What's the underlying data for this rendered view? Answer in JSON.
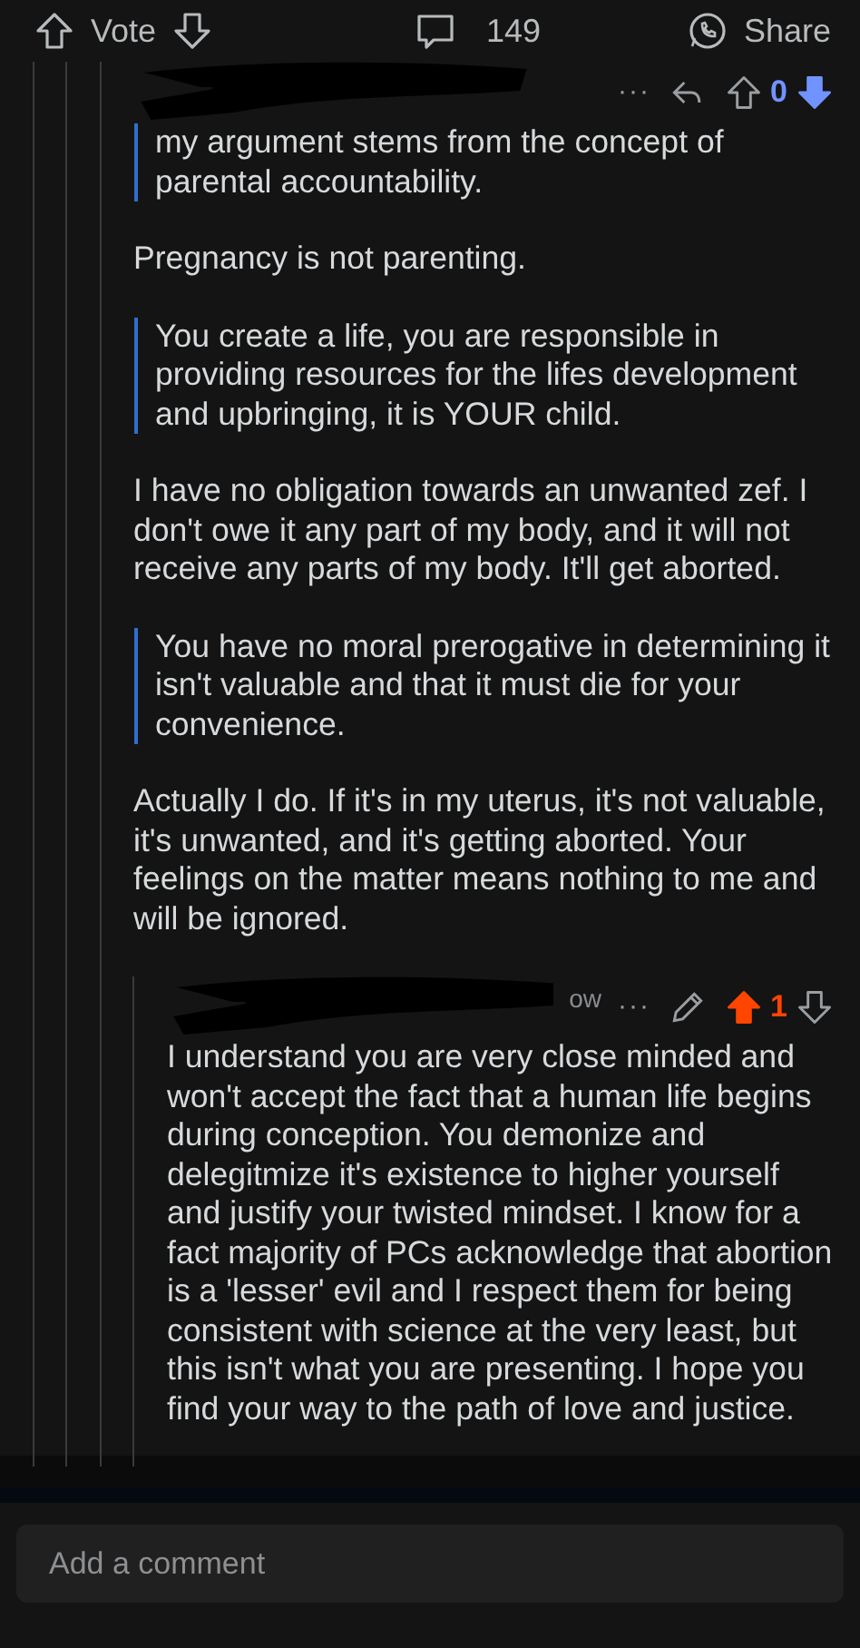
{
  "post_bar": {
    "vote_label": "Vote",
    "comment_count": "149",
    "share_label": "Share"
  },
  "comments": [
    {
      "more": "···",
      "own": false,
      "score": "0",
      "upvoted": false,
      "downvoted": true,
      "blocks": [
        {
          "kind": "quote",
          "text": "my argument stems from the concept of parental accountability."
        },
        {
          "kind": "paragraph",
          "text": "Pregnancy is not parenting."
        },
        {
          "kind": "quote",
          "text": "You create a life, you are responsible in providing resources for the lifes development and upbringing, it is YOUR child."
        },
        {
          "kind": "paragraph",
          "text": "I have no obligation towards an unwanted zef. I don't owe it any part of my body, and it will not receive any parts of my body. It'll get aborted."
        },
        {
          "kind": "quote",
          "text": "You have no moral prerogative in determining it isn't valuable and that it must die for your convenience."
        },
        {
          "kind": "paragraph",
          "text": "Actually I do. If it's in my uterus, it's not valuable, it's unwanted, and it's getting aborted. Your feelings on the matter means nothing to me and will be ignored."
        }
      ],
      "children": [
        {
          "age_partial": "ow",
          "more": "···",
          "own": true,
          "score": "1",
          "upvoted": true,
          "downvoted": false,
          "blocks": [
            {
              "kind": "paragraph",
              "text": "I understand you are very close minded and won't accept the fact that a human life begins during conception. You demonize and delegitmize it's existence to higher yourself and justify your twisted mindset. I know for a fact majority of PCs acknowledge that abortion is a 'lesser' evil and I respect them for being consistent with science at the very least, but this isn't what you are presenting. I hope you find your way to the path of love and justice."
            }
          ]
        }
      ]
    }
  ],
  "comment_field": {
    "placeholder": "Add a comment"
  }
}
